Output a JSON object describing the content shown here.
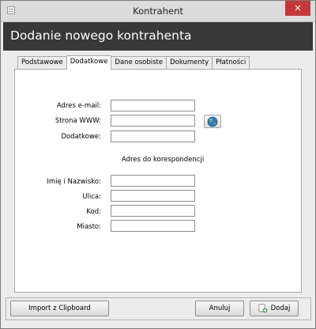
{
  "window": {
    "title": "Kontrahent",
    "close_glyph": "✕"
  },
  "header": {
    "title": "Dodanie nowego kontrahenta"
  },
  "tabs": [
    {
      "label": "Podstawowe",
      "active": false
    },
    {
      "label": "Dodatkowe",
      "active": true
    },
    {
      "label": "Dane osobiste",
      "active": false
    },
    {
      "label": "Dokumenty",
      "active": false
    },
    {
      "label": "Płatności",
      "active": false
    }
  ],
  "form": {
    "email_label": "Adres e-mail:",
    "www_label": "Strona WWW:",
    "extra_label": "Dodatkowe:",
    "email_value": "",
    "www_value": "",
    "extra_value": "",
    "globe_icon": "globe-icon"
  },
  "correspondence": {
    "section_title": "Adres do korespondencji",
    "name_label": "Imię i Nazwisko:",
    "street_label": "Ulica:",
    "code_label": "Kod:",
    "city_label": "Miasto:",
    "name_value": "",
    "street_value": "",
    "code_value": "",
    "city_value": ""
  },
  "footer": {
    "import_label": "Import z Clipboard",
    "cancel_label": "Anuluj",
    "add_label": "Dodaj"
  }
}
